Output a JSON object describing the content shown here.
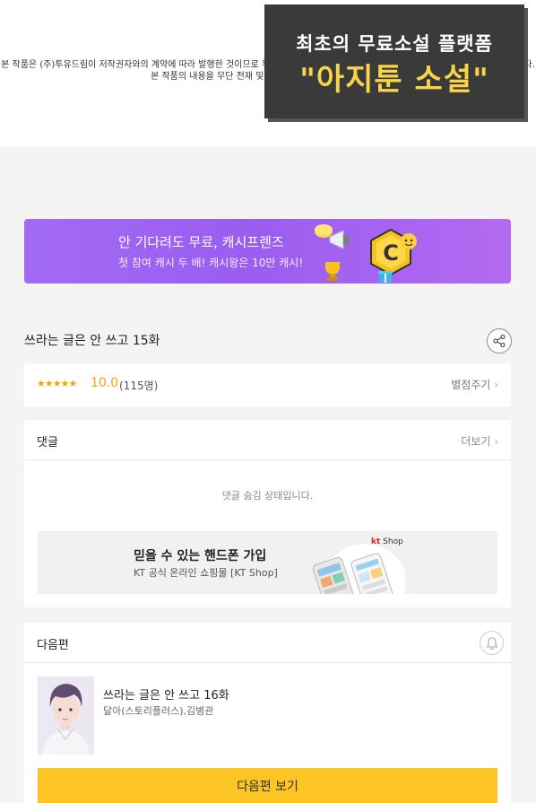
{
  "copyright": {
    "line1": "본 작품은 (주)투유드림이 저작권자와의 계약에 따라 발행한 것이므로 무단 복제를 금지하며, 이를 어길 시 저작권법에 따라 처벌될 수 있습니다.",
    "line2": "본 작품의 내용을 무단 전재 및 무단 복제하는 것을 금지합니다."
  },
  "promo_overlay": {
    "line1": "최초의 무료소설 플랫폼",
    "line2": "\"아지툰 소설\""
  },
  "cash_banner": {
    "title": "안 기다려도 무료, 캐시프렌즈",
    "subtitle": "첫 참여 캐시 두 배! 캐시왕은 10만 캐시!",
    "coin_letter": "C"
  },
  "episode": {
    "title": "쓰라는 글은 안 쓰고 15화"
  },
  "rating": {
    "stars": "★★★★★",
    "score": "10.0",
    "count": "(115명)",
    "rate_link": "별점주기"
  },
  "comments": {
    "heading": "댓글",
    "more": "더보기",
    "hidden_message": "댓글 숨김 상태입니다."
  },
  "kt_ad": {
    "title": "믿을 수 있는 핸드폰 가입",
    "subtitle": "KT 공식 온라인 쇼핑몰 [KT Shop]",
    "logo_kt": "kt",
    "logo_shop": "Shop"
  },
  "next": {
    "heading": "다음편",
    "episode_title": "쓰라는 글은 안 쓰고 16화",
    "authors": "달아(스토리플러스),김병관",
    "button": "다음편 보기"
  }
}
